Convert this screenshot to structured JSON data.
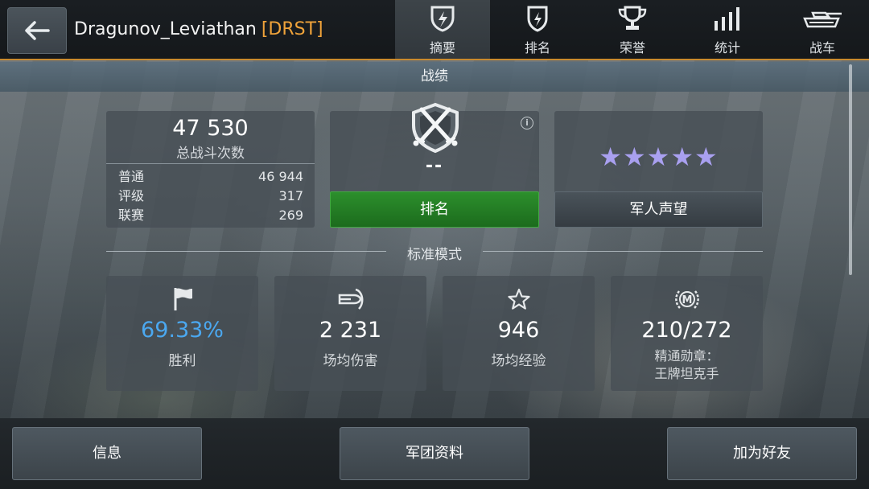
{
  "header": {
    "player_name": "Dragunov_Leviathan",
    "clan_tag": "[DRST]",
    "tabs": [
      {
        "label": "摘要",
        "icon": "summary-shield-icon",
        "active": true
      },
      {
        "label": "排名",
        "icon": "rating-shield-icon",
        "active": false
      },
      {
        "label": "荣誉",
        "icon": "trophy-icon",
        "active": false
      },
      {
        "label": "统计",
        "icon": "stats-bars-icon",
        "active": false
      },
      {
        "label": "战车",
        "icon": "tank-icon",
        "active": false
      }
    ]
  },
  "section_title": "战绩",
  "battles": {
    "total": "47 530",
    "total_label": "总战斗次数",
    "rows": [
      {
        "label": "普通",
        "value": "46 944"
      },
      {
        "label": "评级",
        "value": "317"
      },
      {
        "label": "联赛",
        "value": "269"
      }
    ]
  },
  "rank": {
    "value": "--",
    "button_label": "排名",
    "info": "i"
  },
  "reputation": {
    "stars": "★★★★★",
    "star_count": 5,
    "button_label": "军人声望",
    "star_color": "#a9a0f0"
  },
  "mode_label": "标准模式",
  "stats": [
    {
      "value": "69.33%",
      "label": "胜利",
      "icon": "flag-icon"
    },
    {
      "value": "2 231",
      "label": "场均伤害",
      "icon": "shell-damage-icon"
    },
    {
      "value": "946",
      "label": "场均经验",
      "icon": "star-outline-icon"
    },
    {
      "value": "210/272",
      "label": "精通勋章：",
      "label2": "王牌坦克手",
      "icon": "mastery-badge-icon",
      "badge_letter": "M"
    }
  ],
  "bottom_buttons": {
    "info": "信息",
    "clan": "军团资料",
    "add_friend": "加为好友"
  },
  "colors": {
    "accent": "#c98a2e",
    "clan_tag": "#f0a33a",
    "win_rate": "#4ba8f0",
    "rank_button": "#2c8f2c"
  }
}
